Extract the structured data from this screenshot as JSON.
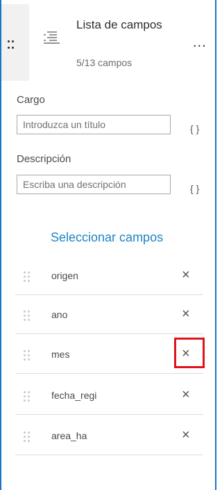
{
  "header": {
    "title": "Lista de campos",
    "subtitle": "5/13 campos",
    "drag_icon": "drag-handle-icon",
    "list_icon": "field-list-icon",
    "more_label": "..."
  },
  "form": {
    "title_label": "Cargo",
    "title_placeholder": "Introduzca un título",
    "description_label": "Descripción",
    "description_placeholder": "Escriba una descripción",
    "expression_label": "{ }"
  },
  "select_fields_label": "Seleccionar campos",
  "fields": [
    {
      "name": "origen",
      "remove": "×"
    },
    {
      "name": "ano",
      "remove": "×"
    },
    {
      "name": "mes",
      "remove": "×"
    },
    {
      "name": "fecha_regi",
      "remove": "×"
    },
    {
      "name": "area_ha",
      "remove": "×"
    }
  ],
  "colors": {
    "accent": "#1d84c4",
    "border": "#1a73c9",
    "highlight": "#e0131b"
  }
}
